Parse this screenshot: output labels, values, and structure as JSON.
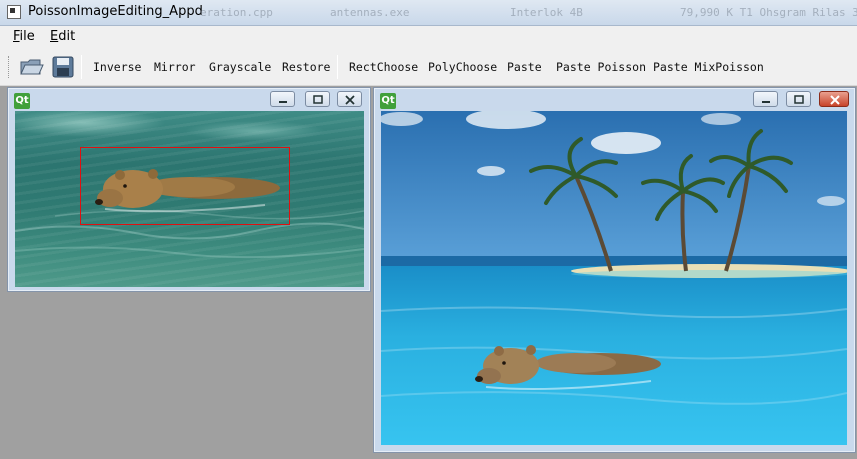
{
  "window": {
    "title": "PoissonImageEditing_Appd",
    "background_texts": [
      "eration.cpp",
      "antennas.exe",
      "Interlok  4B",
      "79,990 K  T1 Ohsgram Rilas 3"
    ]
  },
  "menubar": {
    "items": [
      {
        "mnemonic": "F",
        "rest": "ile"
      },
      {
        "mnemonic": "E",
        "rest": "dit"
      }
    ]
  },
  "toolbar": {
    "icons": [
      "open-folder-icon",
      "save-disk-icon"
    ],
    "buttons": [
      "Inverse",
      "Mirror",
      "Grayscale",
      "Restore",
      "RectChoose",
      "PolyChoose",
      "Paste",
      "Paste Poisson",
      "Paste MixPoisson"
    ]
  },
  "subwindows": {
    "source": {
      "badge": "Qt",
      "image": "bear swimming in green water with red rectangular selection"
    },
    "target": {
      "badge": "Qt",
      "image": "tropical island with three palm trees and blue sea with pasted bear"
    }
  },
  "colors": {
    "selection": "#e01010",
    "close_button": "#c8442a",
    "qt_badge": "#41a03b"
  }
}
